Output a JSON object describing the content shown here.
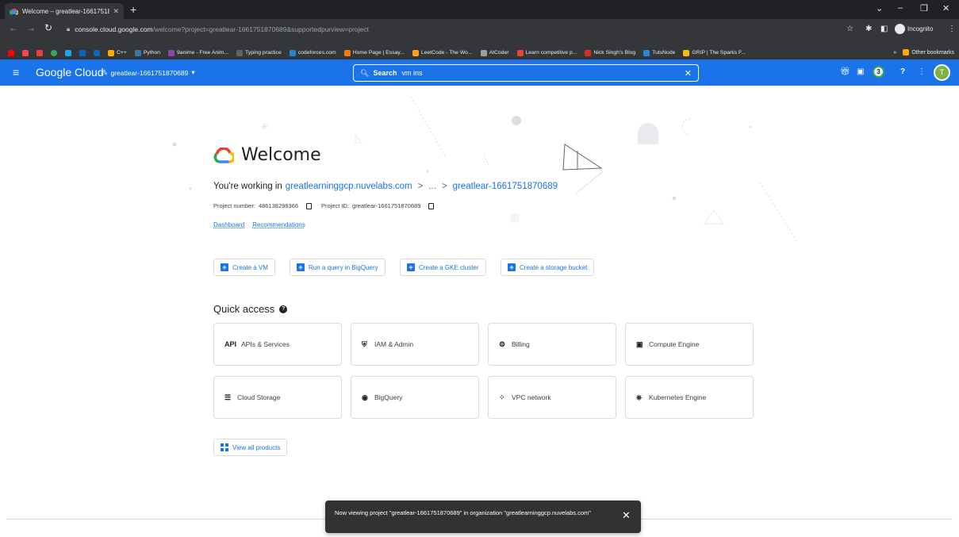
{
  "browser": {
    "tab_title": "Welcome – greatlear-16617518",
    "url_host": "console.cloud.google.com",
    "url_path": "/welcome?project=greatlear-1661751870689&supportedpurview=project",
    "incognito_label": "Incognito",
    "bookmarks": [
      {
        "label": "C++",
        "color": "#f9ab00"
      },
      {
        "label": "Python",
        "color": "#3776ab"
      },
      {
        "label": "9anime - Free Anim...",
        "color": "#8e44ad"
      },
      {
        "label": "Typing practice",
        "color": "#5f6368"
      },
      {
        "label": "codeforces.com",
        "color": "#1f8acb"
      },
      {
        "label": "Home Page | Essay...",
        "color": "#f57c00"
      },
      {
        "label": "LeetCode - The Wo...",
        "color": "#ffa116"
      },
      {
        "label": "AtCoder",
        "color": "#9aa0a6"
      },
      {
        "label": "Learn competitive p...",
        "color": "#ea4335"
      },
      {
        "label": "Nick Singh's Blog",
        "color": "#d93025"
      },
      {
        "label": "TutsNode",
        "color": "#1e88e5"
      },
      {
        "label": "GRIP | The Sparks F...",
        "color": "#fbbc04"
      }
    ],
    "other_bookmarks": "Other bookmarks"
  },
  "header": {
    "logo_text": "Google Cloud",
    "project": "greatlear-1661751870689",
    "search_label": "Search",
    "search_value": "vm ins",
    "notification_count": "3",
    "avatar_initial": "T"
  },
  "welcome": {
    "title": "Welcome",
    "working_prefix": "You're working in",
    "org": "greatlearninggcp.nuvelabs.com",
    "sep1": ">",
    "ellipsis": "...",
    "sep2": ">",
    "project": "greatlear-1661751870689",
    "project_number_label": "Project number:",
    "project_number": "486138298366",
    "project_id_label": "Project ID:",
    "project_id": "greatlear-1661751870689",
    "links": [
      "Dashboard",
      "Recommendations"
    ]
  },
  "actions": [
    "Create a VM",
    "Run a query in BigQuery",
    "Create a GKE cluster",
    "Create a storage bucket"
  ],
  "quick_access": {
    "title": "Quick access",
    "items": [
      {
        "label": "APIs & Services",
        "icon": "API"
      },
      {
        "label": "IAM & Admin",
        "icon": "⛨"
      },
      {
        "label": "Billing",
        "icon": "⚙"
      },
      {
        "label": "Compute Engine",
        "icon": "▣"
      },
      {
        "label": "Cloud Storage",
        "icon": "☰"
      },
      {
        "label": "BigQuery",
        "icon": "◉"
      },
      {
        "label": "VPC network",
        "icon": "⁘"
      },
      {
        "label": "Kubernetes Engine",
        "icon": "⎈"
      }
    ],
    "view_all": "View all products"
  },
  "toast": {
    "message": "Now viewing project \"greatlear-1661751870689\" in organization \"greatlearninggcp.nuvelabs.com\""
  }
}
